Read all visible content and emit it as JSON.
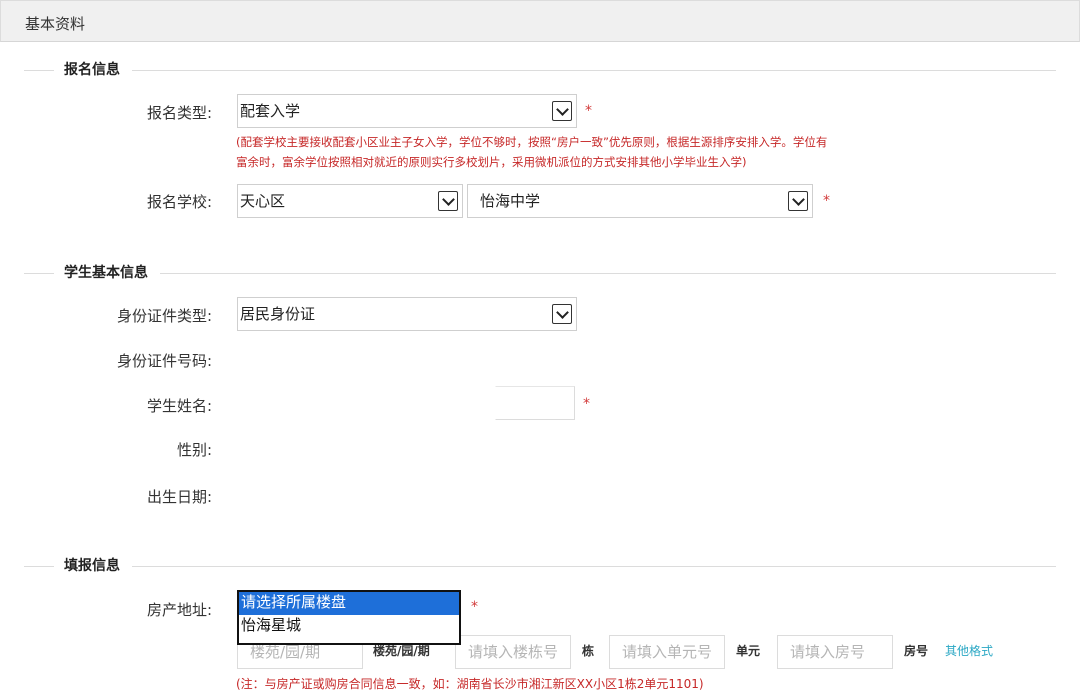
{
  "header": {
    "title": "基本资料"
  },
  "sections": {
    "signup": {
      "title": "报名信息"
    },
    "student": {
      "title": "学生基本信息"
    },
    "fill": {
      "title": "填报信息"
    }
  },
  "signup": {
    "type_label": "报名类型:",
    "type_value": "配套入学",
    "type_note_line1": "(配套学校主要接收配套小区业主子女入学，学位不够时，按照“房户一致”优先原则，根据生源排序安排入学。学位有",
    "type_note_line2": "富余时，富余学位按照相对就近的原则实行多校划片，采用微机派位的方式安排其他小学毕业生入学)",
    "school_label": "报名学校:",
    "district_value": "天心区",
    "school_value": "怡海中学"
  },
  "student": {
    "id_type_label": "身份证件类型:",
    "id_type_value": "居民身份证",
    "id_number_label": "身份证件号码:",
    "name_label": "学生姓名:",
    "gender_label": "性别:",
    "birth_label": "出生日期:"
  },
  "fill": {
    "address_label": "房产地址:",
    "address_options": [
      "请选择所属楼盘",
      "怡海星城"
    ],
    "estate_placeholder": "楼苑/园/期",
    "estate_unit": "楼苑/园/期",
    "building_placeholder": "请填入楼栋号",
    "building_unit": "栋",
    "unit_placeholder": "请填入单元号",
    "unit_unit": "单元",
    "room_placeholder": "请填入房号",
    "room_unit": "房号",
    "other_format": "其他格式",
    "note": "(注：与房产证或购房合同信息一致，如：湖南省长沙市湘江新区XX小区1栋2单元1101)"
  },
  "required_mark": "*",
  "colors": {
    "required": "#d23a3a",
    "note": "#c62828",
    "link": "#2aa7c4",
    "selection": "#1e6fd9"
  }
}
